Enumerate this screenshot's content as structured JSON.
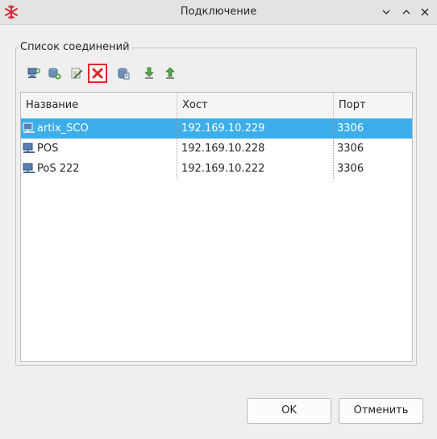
{
  "window": {
    "title": "Подключение"
  },
  "group": {
    "title": "Список соединений"
  },
  "toolbar": {
    "buttons": [
      {
        "icon": "new-connection-icon"
      },
      {
        "icon": "add-database-icon"
      },
      {
        "icon": "edit-icon"
      },
      {
        "icon": "delete-icon",
        "active": true
      },
      {
        "icon": "database-properties-icon"
      },
      {
        "icon": "import-icon"
      },
      {
        "icon": "export-icon"
      }
    ]
  },
  "table": {
    "columns": [
      "Название",
      "Хост",
      "Порт"
    ],
    "rows": [
      {
        "name": "artix_SCO",
        "host": "192.169.10.229",
        "port": "3306",
        "selected": true
      },
      {
        "name": "POS",
        "host": "192.169.10.228",
        "port": "3306",
        "selected": false
      },
      {
        "name": "PoS 222",
        "host": "192.169.10.222",
        "port": "3306",
        "selected": false
      }
    ]
  },
  "buttons": {
    "ok_label": "OK",
    "cancel_label": "Отменить"
  },
  "colors": {
    "selection": "#3daee9",
    "delete_red": "#e3262c",
    "dialog_bg": "#efefef"
  }
}
